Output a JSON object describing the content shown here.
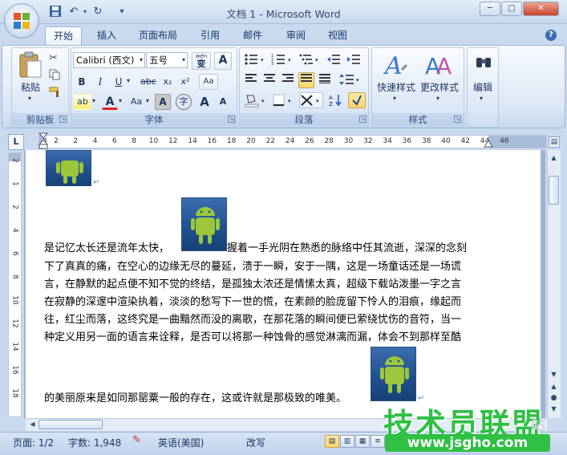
{
  "window": {
    "title": "文档 1 - Microsoft Word",
    "minimize": "─",
    "maximize": "□",
    "close": "✕"
  },
  "quick_access": {
    "save_icon": "save-icon",
    "undo_icon": "undo-icon",
    "redo_icon": "redo-icon",
    "customize": "▾"
  },
  "tabs": [
    {
      "label": "开始",
      "active": true
    },
    {
      "label": "插入"
    },
    {
      "label": "页面布局"
    },
    {
      "label": "引用"
    },
    {
      "label": "邮件"
    },
    {
      "label": "审阅"
    },
    {
      "label": "视图"
    }
  ],
  "ribbon": {
    "clipboard": {
      "label": "剪贴板",
      "paste": "粘贴"
    },
    "font": {
      "label": "字体",
      "font_name": "Calibri (西文)",
      "font_size": "五号",
      "wen": "wén",
      "wen_char": "变",
      "a_box": "A",
      "bold": "B",
      "italic": "I",
      "underline": "U",
      "strike": "abc",
      "sub": "x₂",
      "sup": "x²",
      "clear": "Aa",
      "highlight": "ab",
      "font_color": "A",
      "case": "Aa",
      "char_shade": "A",
      "enclose": "字",
      "grow": "A",
      "shrink": "A"
    },
    "paragraph": {
      "label": "段落"
    },
    "styles": {
      "label": "样式",
      "quick": "快速样式",
      "change": "更改样式"
    },
    "editing": {
      "label": "编辑"
    }
  },
  "ruler": {
    "corner": "L",
    "h_ticks": [
      "4",
      "2",
      "2",
      "4",
      "6",
      "8",
      "10",
      "12",
      "14",
      "16",
      "18",
      "20",
      "22",
      "24",
      "26",
      "28",
      "30",
      "32",
      "34",
      "36",
      "38",
      "40",
      "42",
      "44",
      "46"
    ],
    "v_ticks": [
      "2",
      "1",
      "2",
      "4",
      "6",
      "8",
      "10",
      "12",
      "14",
      "16",
      "18"
    ]
  },
  "document": {
    "lines": [
      "是记忆太长还是流年太快，",
      "握着一手光阴在熟悉的脉络中任其流逝，深深的念刻",
      "下了真真的痛，在空心的边缘无尽的蔓延，溃于一瞬，安于一隅，这是一场童话还是一场谎",
      "言，在静默的起点便不知不觉的终结，是孤独太浓还是情愫太真，超级下载站泼墨一字之言",
      "在寂静的深邃中渲染执着，淡淡的愁写下一世的慌，在素颜的脸庞留下怜人的泪痕，缘起而",
      "往，红尘而落，这终究是一曲黯然而没的离歌，在那花落的瞬间便已萦绕忧伤的音符，当一",
      "种定义用另一面的语言来诠释，是否可以将那一种蚀骨的感觉淋漓而漏，体会不到那样至酷",
      "的美丽原来是如同那罂粟一般的存在，这或许就是那极致的唯美。"
    ],
    "para_mark": "↵"
  },
  "status": {
    "page": "页面: 1/2",
    "words": "字数: 1,948",
    "language": "英语(美国)",
    "mode": "改写"
  },
  "watermark": {
    "title": "技术员联盟",
    "url": "www.jsgho.com",
    "station": "站"
  },
  "colors": {
    "accent": "#2fc044",
    "ribbon": "#dbe7f5",
    "highlight_yellow": "#fbd56a",
    "font_red": "#e02020"
  }
}
